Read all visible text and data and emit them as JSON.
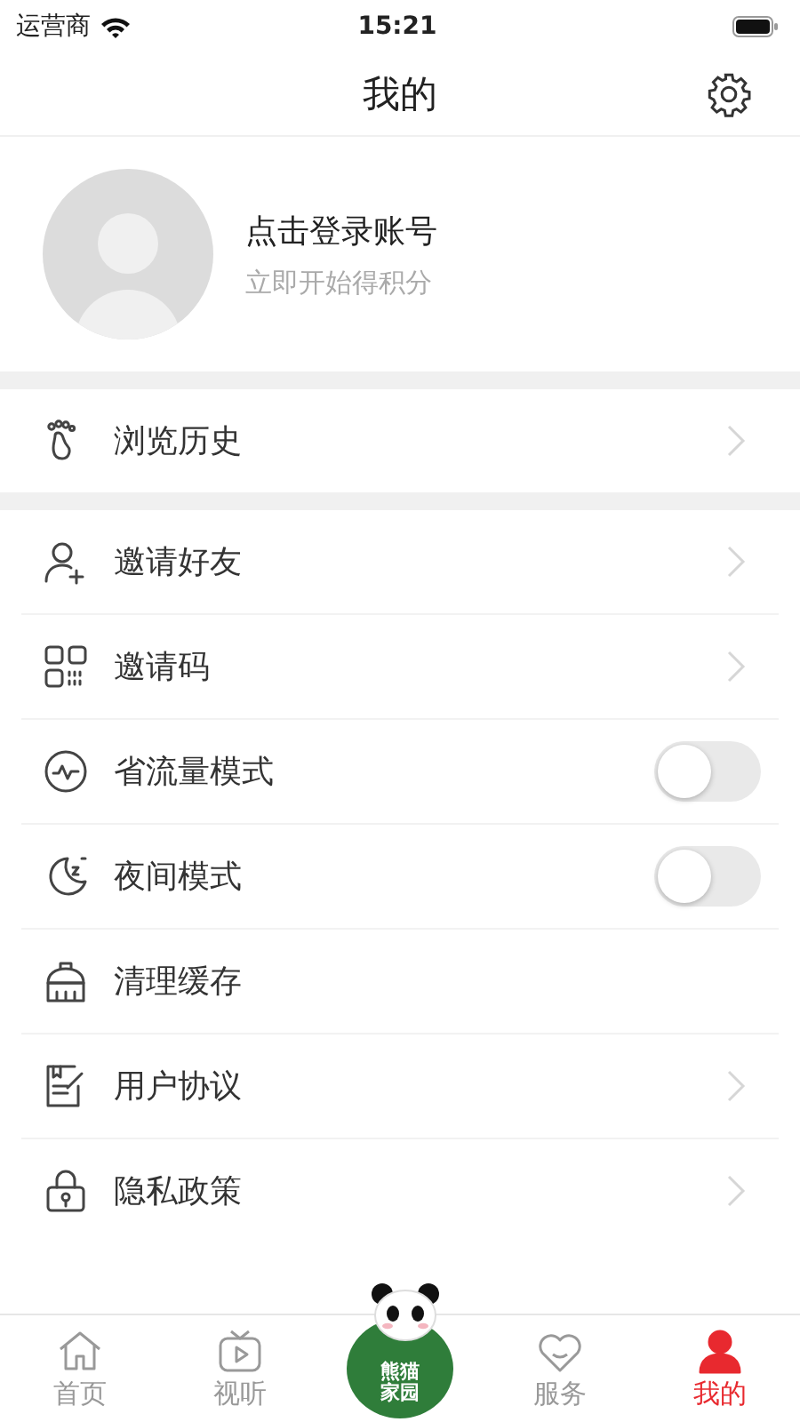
{
  "status_bar": {
    "carrier": "运营商",
    "time": "15:21"
  },
  "header": {
    "title": "我的"
  },
  "profile": {
    "name": "点击登录账号",
    "subtitle": "立即开始得积分"
  },
  "menu_groups": [
    {
      "items": [
        {
          "kind": "link",
          "label": "浏览历史"
        }
      ]
    },
    {
      "items": [
        {
          "kind": "link",
          "label": "邀请好友"
        },
        {
          "kind": "link",
          "label": "邀请码"
        },
        {
          "kind": "toggle",
          "label": "省流量模式",
          "on": false
        },
        {
          "kind": "toggle",
          "label": "夜间模式",
          "on": false
        },
        {
          "kind": "plain",
          "label": "清理缓存"
        },
        {
          "kind": "link",
          "label": "用户协议"
        },
        {
          "kind": "link",
          "label": "隐私政策"
        }
      ]
    }
  ],
  "tab_bar": [
    {
      "kind": "tab",
      "label": "首页",
      "selected": false
    },
    {
      "kind": "tab",
      "label": "视听",
      "selected": false
    },
    {
      "kind": "logo",
      "label": "熊猫家园"
    },
    {
      "kind": "tab",
      "label": "服务",
      "selected": false
    },
    {
      "kind": "tab",
      "label": "我的",
      "selected": true
    }
  ]
}
